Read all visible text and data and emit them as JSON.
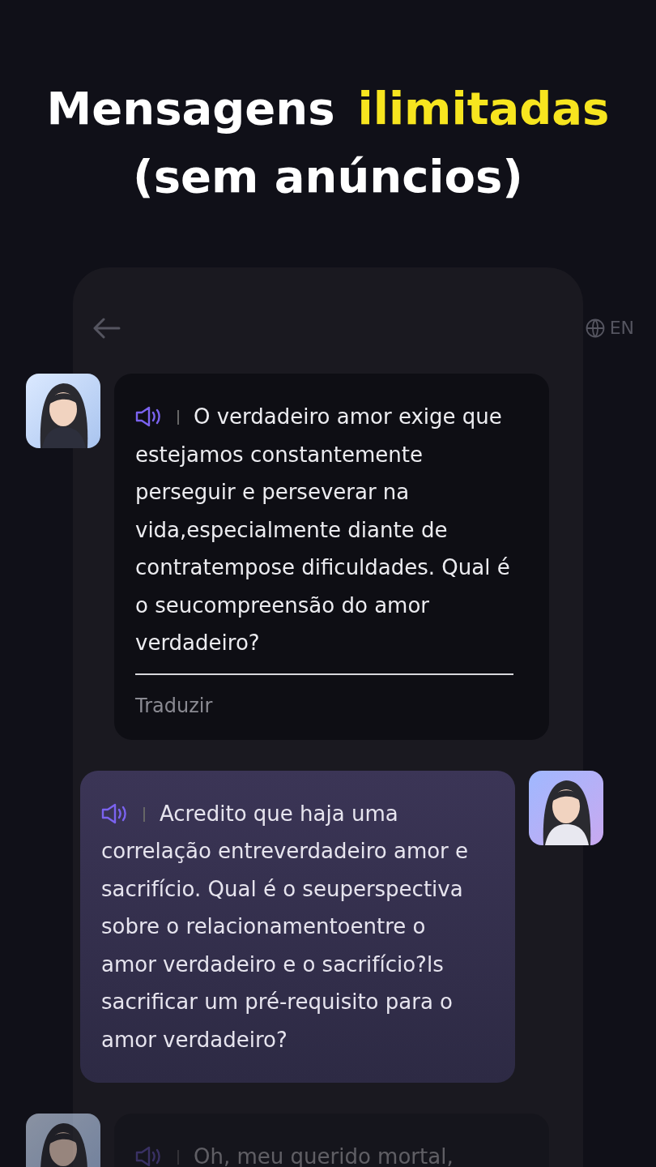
{
  "headline": {
    "line1": [
      {
        "text": "Mensagens",
        "highlight": false
      },
      {
        "text": "ilimitadas",
        "highlight": true
      }
    ],
    "line2": "(sem anúncios)"
  },
  "chat_header": {
    "language": "EN"
  },
  "messages": [
    {
      "kind": "bot",
      "text": "O verdadeiro amor exige que estejamos constantemente perseguir e perseverar na vida,especialmente diante de contratempose dificuldades. Qual é o seucompreensão do amor verdadeiro?",
      "translate": "Traduzir",
      "dimmed": false
    },
    {
      "kind": "user",
      "text": "Acredito que haja uma correlação entreverdadeiro amor e sacrifício. Qual é o seuperspectiva sobre o relacionamentoentre o amor verdadeiro e o sacrifício?ls sacrificar um pré-requisito para o amor verdadeiro?",
      "dimmed": false
    },
    {
      "kind": "bot",
      "text": "Oh, meu querido mortal,",
      "dimmed": true
    }
  ]
}
